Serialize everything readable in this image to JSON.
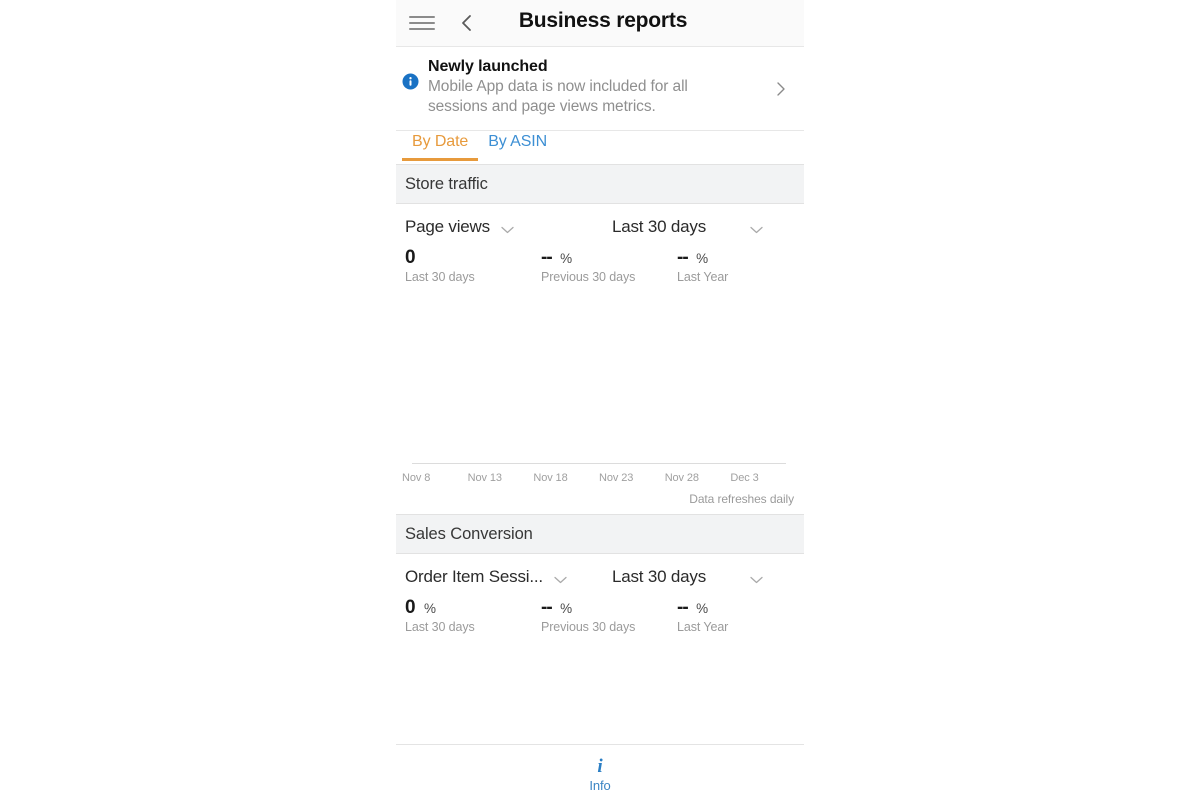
{
  "appbar": {
    "menu_icon": "hamburger-menu-icon",
    "back_icon": "back-chevron-icon",
    "title": "Business reports"
  },
  "banner": {
    "icon": "info-circle-icon",
    "title": "Newly launched",
    "body": "Mobile App data is now included for all sessions and page views metrics.",
    "chevron_icon": "chevron-right-icon"
  },
  "tabs": [
    {
      "label": "By Date",
      "active": true,
      "color": "#e79a3c"
    },
    {
      "label": "By ASIN",
      "active": false,
      "color": "#3d8fd4"
    }
  ],
  "sections": [
    {
      "band_title": "Store traffic",
      "metric_selector": {
        "value": "Page views",
        "chevron_icon": "chevron-down-icon"
      },
      "range_selector": {
        "value": "Last 30 days",
        "chevron_icon": "chevron-down-icon"
      },
      "stats": [
        {
          "value": "0",
          "unit": "",
          "label": "Last 30 days"
        },
        {
          "value": "--",
          "unit": "%",
          "label": "Previous 30 days"
        },
        {
          "value": "--",
          "unit": "%",
          "label": "Last Year"
        }
      ],
      "footnote": "Data refreshes daily"
    },
    {
      "band_title": "Sales Conversion",
      "metric_selector": {
        "value": "Order Item Sessi...",
        "chevron_icon": "chevron-down-icon"
      },
      "range_selector": {
        "value": "Last 30 days",
        "chevron_icon": "chevron-down-icon"
      },
      "stats": [
        {
          "value": "0",
          "unit": "%",
          "label": "Last 30 days"
        },
        {
          "value": "--",
          "unit": "%",
          "label": "Previous 30 days"
        },
        {
          "value": "--",
          "unit": "%",
          "label": "Last Year"
        }
      ],
      "footnote": ""
    }
  ],
  "chart_data": {
    "type": "line",
    "title": "Page views",
    "xlabel": "",
    "ylabel": "Page views",
    "x": [
      "Nov 8",
      "Nov 13",
      "Nov 18",
      "Nov 23",
      "Nov 28",
      "Dec 3"
    ],
    "tick_labels": [
      "Nov 8",
      "Nov 13",
      "Nov 18",
      "Nov 23",
      "Nov 28",
      "Dec 3"
    ],
    "series": [
      {
        "name": "Page views",
        "values": [
          0,
          0,
          0,
          0,
          0,
          0
        ]
      }
    ],
    "ylim": [
      0,
      0
    ],
    "grid": false,
    "legend": "none",
    "note": "Empty plot area — no data plotted; only the horizontal x-axis baseline and date ticks are rendered.",
    "annotations": [
      "Data refreshes daily"
    ]
  },
  "bottombar": {
    "icon": "info-icon",
    "icon_glyph": "i",
    "label": "Info",
    "color": "#3c85c4"
  }
}
